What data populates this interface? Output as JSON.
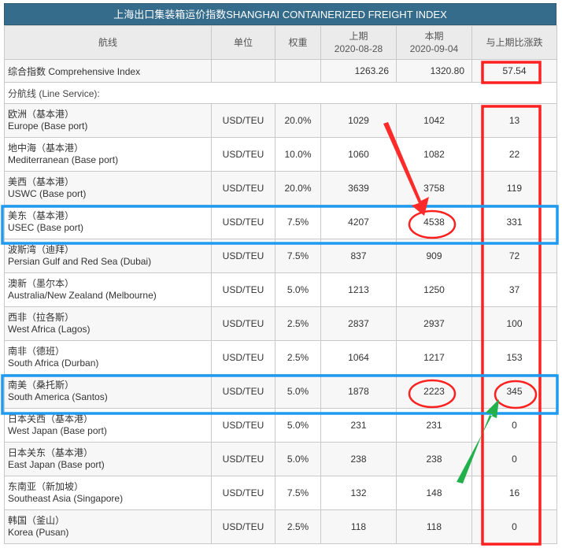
{
  "title": "上海出口集装箱运价指数SHANGHAI CONTAINERIZED FREIGHT INDEX",
  "headers": {
    "route": "航线",
    "unit": "单位",
    "weight": "权重",
    "prev_label": "上期",
    "prev_date": "2020-08-28",
    "curr_label": "本期",
    "curr_date": "2020-09-04",
    "change": "与上期比涨跌"
  },
  "composite": {
    "name": "综合指数 Comprehensive Index",
    "prev": "1263.26",
    "curr": "1320.80",
    "change": "57.54"
  },
  "section_label": "分航线 (Line Service):",
  "routes": [
    {
      "cn": "欧洲（基本港）",
      "en": "Europe (Base port)",
      "unit": "USD/TEU",
      "weight": "20.0%",
      "prev": "1029",
      "curr": "1042",
      "change": "13"
    },
    {
      "cn": "地中海（基本港）",
      "en": "Mediterranean (Base port)",
      "unit": "USD/TEU",
      "weight": "10.0%",
      "prev": "1060",
      "curr": "1082",
      "change": "22"
    },
    {
      "cn": "美西（基本港）",
      "en": "USWC (Base port)",
      "unit": "USD/TEU",
      "weight": "20.0%",
      "prev": "3639",
      "curr": "3758",
      "change": "119"
    },
    {
      "cn": "美东（基本港）",
      "en": "USEC (Base port)",
      "unit": "USD/TEU",
      "weight": "7.5%",
      "prev": "4207",
      "curr": "4538",
      "change": "331"
    },
    {
      "cn": "波斯湾（迪拜）",
      "en": "Persian Gulf and Red Sea (Dubai)",
      "unit": "USD/TEU",
      "weight": "7.5%",
      "prev": "837",
      "curr": "909",
      "change": "72"
    },
    {
      "cn": "澳新（墨尔本）",
      "en": "Australia/New Zealand (Melbourne)",
      "unit": "USD/TEU",
      "weight": "5.0%",
      "prev": "1213",
      "curr": "1250",
      "change": "37"
    },
    {
      "cn": "西非（拉各斯）",
      "en": "West Africa (Lagos)",
      "unit": "USD/TEU",
      "weight": "2.5%",
      "prev": "2837",
      "curr": "2937",
      "change": "100"
    },
    {
      "cn": "南非（德班）",
      "en": "South Africa (Durban)",
      "unit": "USD/TEU",
      "weight": "2.5%",
      "prev": "1064",
      "curr": "1217",
      "change": "153"
    },
    {
      "cn": "南美（桑托斯）",
      "en": "South America (Santos)",
      "unit": "USD/TEU",
      "weight": "5.0%",
      "prev": "1878",
      "curr": "2223",
      "change": "345"
    },
    {
      "cn": "日本关西（基本港）",
      "en": "West Japan (Base port)",
      "unit": "USD/TEU",
      "weight": "5.0%",
      "prev": "231",
      "curr": "231",
      "change": "0"
    },
    {
      "cn": "日本关东（基本港）",
      "en": "East Japan (Base port)",
      "unit": "USD/TEU",
      "weight": "5.0%",
      "prev": "238",
      "curr": "238",
      "change": "0"
    },
    {
      "cn": "东南亚（新加坡）",
      "en": "Southeast Asia (Singapore)",
      "unit": "USD/TEU",
      "weight": "7.5%",
      "prev": "132",
      "curr": "148",
      "change": "16"
    },
    {
      "cn": "韩国（釜山）",
      "en": "Korea (Pusan)",
      "unit": "USD/TEU",
      "weight": "2.5%",
      "prev": "118",
      "curr": "118",
      "change": "0"
    }
  ],
  "colors": {
    "header_bar": "#356c8c",
    "highlight_red": "#ff2020",
    "highlight_blue": "#1e9bf0",
    "arrow_red": "#ff2a2a",
    "arrow_green": "#22b04b"
  }
}
